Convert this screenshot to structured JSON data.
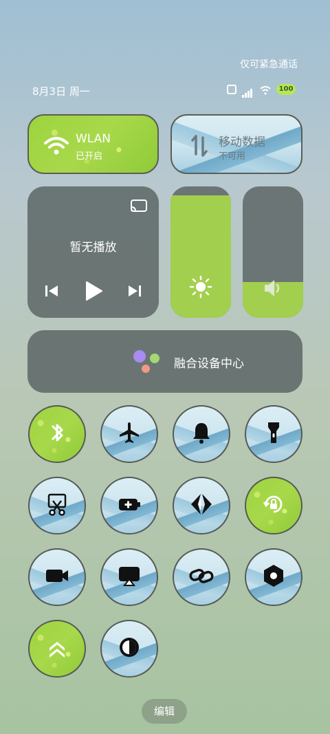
{
  "status": {
    "emergency_text": "仅可紧急通话",
    "date_text": "8月3日 周一",
    "battery_text": "100"
  },
  "tiles": {
    "wlan": {
      "title": "WLAN",
      "subtitle": "已开启",
      "active": true
    },
    "mobile_data": {
      "title": "移动数据",
      "subtitle": "不可用",
      "active": false
    }
  },
  "media": {
    "message": "暂无播放"
  },
  "sliders": {
    "brightness_level": 0.93,
    "volume_level": 0.27
  },
  "fusion_center": {
    "label": "融合设备中心"
  },
  "toggles": [
    {
      "name": "bluetooth",
      "icon": "bluetooth-icon",
      "active": true
    },
    {
      "name": "airplane",
      "icon": "airplane-icon",
      "active": false
    },
    {
      "name": "bell",
      "icon": "bell-icon",
      "active": false
    },
    {
      "name": "flashlight",
      "icon": "flashlight-icon",
      "active": false
    },
    {
      "name": "screenshot",
      "icon": "scissors-icon",
      "active": false
    },
    {
      "name": "battery-saver",
      "icon": "battery-plus-icon",
      "active": false
    },
    {
      "name": "nearby-share",
      "icon": "share-arrows-icon",
      "active": false
    },
    {
      "name": "rotation-lock",
      "icon": "rotation-lock-icon",
      "active": true
    },
    {
      "name": "screen-record",
      "icon": "video-camera-icon",
      "active": false
    },
    {
      "name": "screen-cast",
      "icon": "screencast-icon",
      "active": false
    },
    {
      "name": "link",
      "icon": "link-icon",
      "active": false
    },
    {
      "name": "settings",
      "icon": "hexagon-gear-icon",
      "active": false
    },
    {
      "name": "performance",
      "icon": "double-chevron-up-icon",
      "active": true
    },
    {
      "name": "dark-mode",
      "icon": "contrast-icon",
      "active": false
    }
  ],
  "edit_label": "编辑",
  "colors": {
    "accent_green": "#a3cf4e",
    "dark_tile": "#5f6969"
  }
}
